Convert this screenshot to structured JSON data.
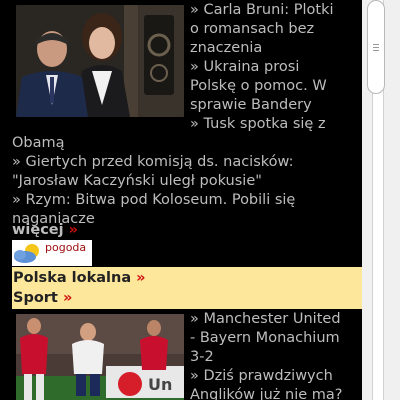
{
  "news_top": [
    "» Carla Bruni: Plotki",
    "o romansach bez",
    "znaczenia",
    "» Ukraina prosi",
    "Polskę o pomoc. W",
    "sprawie Bandery",
    "» Tusk spotka się z"
  ],
  "news_full": [
    "Obamą",
    "» Giertych przed komisją ds. nacisków:",
    "\"Jarosław Kaczyński uległ pokusie\"",
    "» Rzym: Bitwa pod Koloseum. Pobili się",
    "naganiacze"
  ],
  "more": {
    "label": "więcej",
    "arrow": "»"
  },
  "weather": {
    "label": "pogoda"
  },
  "local_links": [
    {
      "label": "Polska lokalna",
      "arrow": "»"
    },
    {
      "label": "Sport",
      "arrow": "»"
    }
  ],
  "sport_news": [
    "» Manchester United",
    "- Bayern Monachium",
    "3-2",
    "» Dziś prawdziwych",
    "Anglików już nie ma?"
  ],
  "colors": {
    "background": "#000000",
    "text": "#bdbdbd",
    "accent_arrow": "#d01010",
    "highlight_band": "#fde79a"
  }
}
